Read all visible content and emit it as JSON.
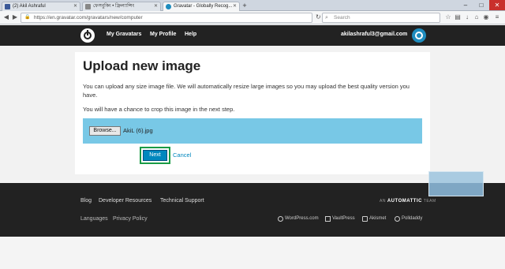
{
  "browser": {
    "tabs": [
      {
        "label": "(2) Akil Ashraful",
        "icon": "facebook-icon",
        "color": "#3b5998"
      },
      {
        "label": "ফেসবুকিং • ফ্রিল্যান্সিং",
        "icon": "page-icon",
        "color": "#666666"
      },
      {
        "label": "Gravatar - Globally Recog...",
        "icon": "gravatar-icon",
        "color": "#1e8cbe"
      }
    ],
    "url": "https://en.gravatar.com/gravatars/new/computer",
    "search_placeholder": "Search"
  },
  "header": {
    "nav": [
      "My Gravatars",
      "My Profile",
      "Help"
    ],
    "email": "akilashraful3@gmail.com"
  },
  "main": {
    "title": "Upload new image",
    "desc": "You can upload any size image file. We will automatically resize large images so you may upload the best quality version you have.",
    "desc2": "You will have a chance to crop this image in the next step.",
    "browse_label": "Browse...",
    "file_name": "AkiL (6).jpg",
    "next_label": "Next",
    "cancel_label": "Cancel"
  },
  "footer": {
    "links": [
      "Blog",
      "Developer Resources",
      "Technical Support"
    ],
    "links2": [
      "Languages",
      "Privacy Policy"
    ],
    "automattic_prefix": "AN",
    "automattic": "AUTOMATTIC",
    "automattic_suffix": "TEAM",
    "brands": [
      "WordPress.com",
      "VaultPress",
      "Akismet",
      "Polldaddy"
    ]
  },
  "colors": {
    "accent": "#0087be",
    "highlight": "#1a9b45",
    "upload_bg": "#78c8e6"
  }
}
